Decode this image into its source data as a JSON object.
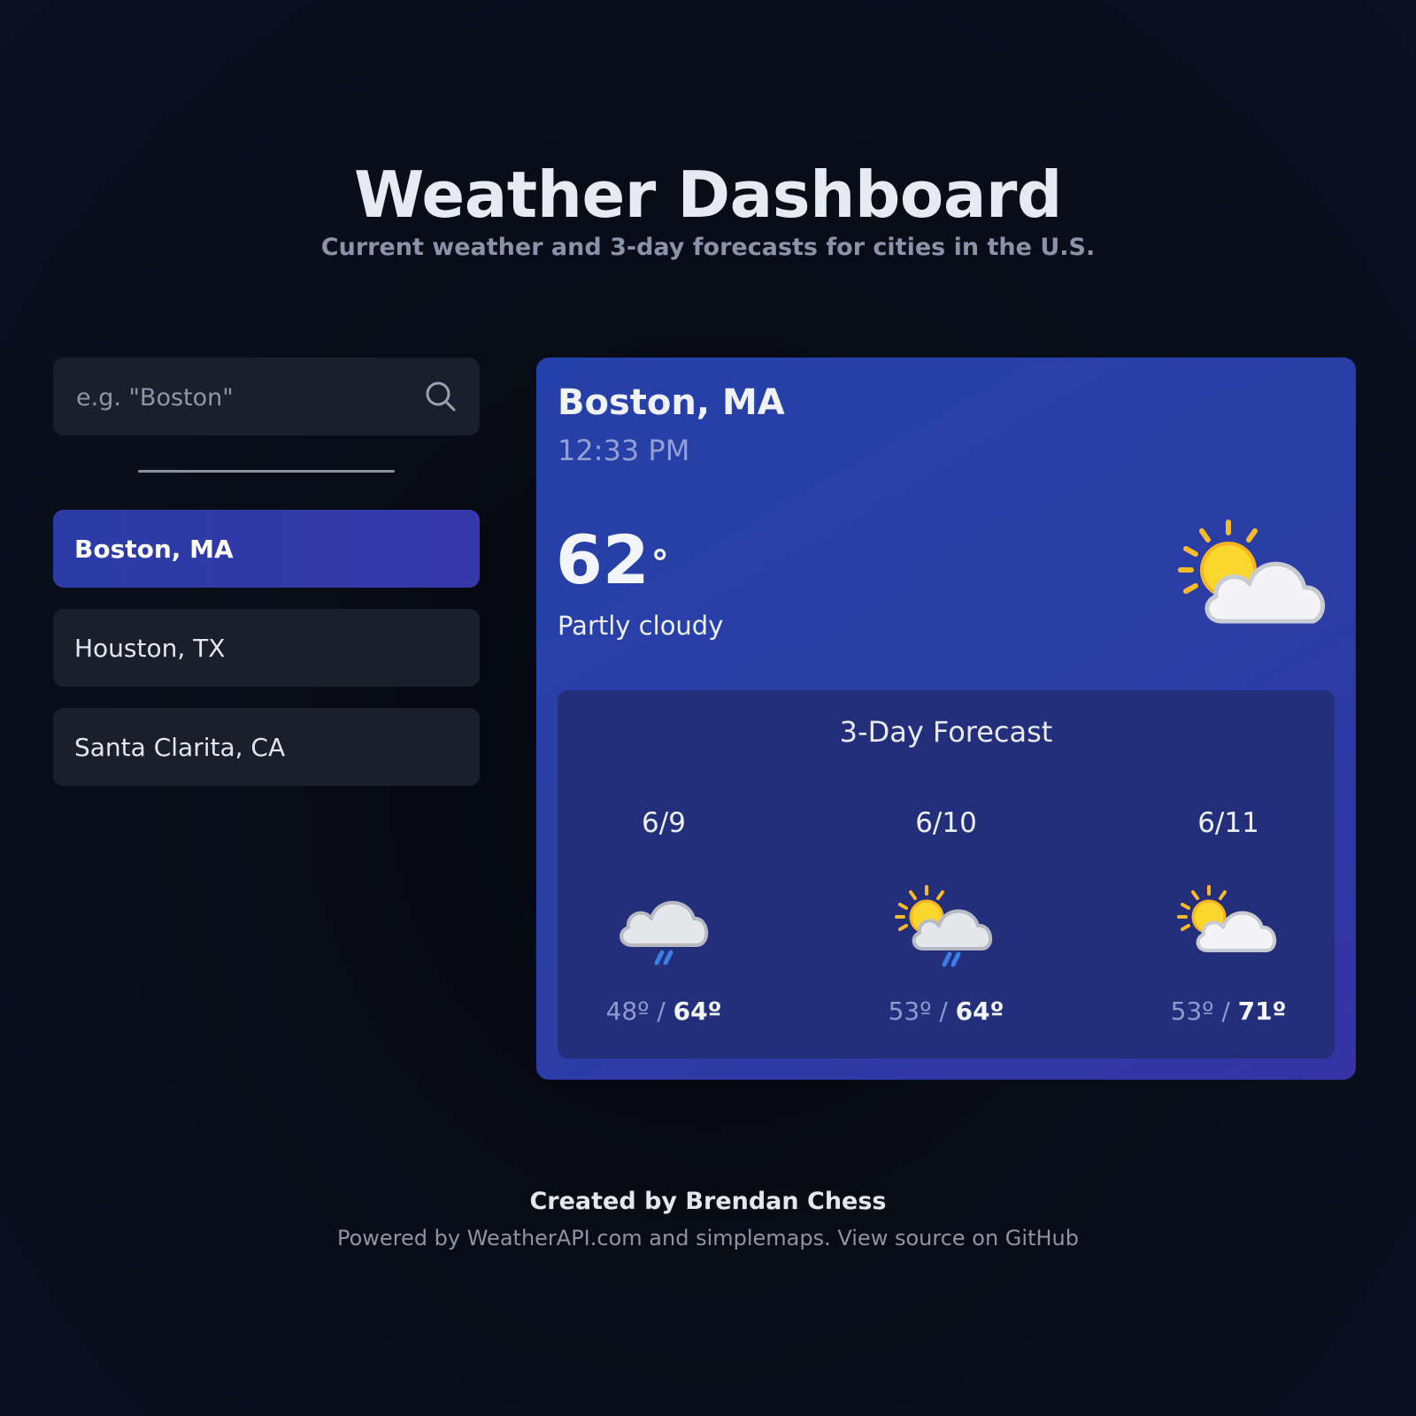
{
  "header": {
    "title": "Weather Dashboard",
    "subtitle": "Current weather and 3-day forecasts for cities in the U.S."
  },
  "search": {
    "placeholder": "e.g. \"Boston\"",
    "value": "",
    "icon": "search-icon"
  },
  "cities": [
    {
      "label": "Boston, MA",
      "active": true
    },
    {
      "label": "Houston, TX",
      "active": false
    },
    {
      "label": "Santa Clarita, CA",
      "active": false
    }
  ],
  "current": {
    "city": "Boston, MA",
    "time": "12:33 PM",
    "temp": "62",
    "degree": "°",
    "condition": "Partly cloudy",
    "icon": "partly-cloudy-icon"
  },
  "forecast": {
    "title": "3-Day Forecast",
    "days": [
      {
        "date": "6/9",
        "icon": "rain-cloud-icon",
        "low": "48º",
        "sep": "/",
        "high": "64º"
      },
      {
        "date": "6/10",
        "icon": "sun-cloud-rain-icon",
        "low": "53º",
        "sep": "/",
        "high": "64º"
      },
      {
        "date": "6/11",
        "icon": "partly-cloudy-icon",
        "low": "53º",
        "sep": "/",
        "high": "71º"
      }
    ]
  },
  "footer": {
    "credit": "Created by Brendan Chess",
    "powered_prefix": "Powered by ",
    "weatherapi": "WeatherAPI.com",
    "and": " and ",
    "simplemaps": "simplemaps",
    "dot": ". ",
    "source": "View source on GitHub"
  },
  "colors": {
    "background": "#0b1120",
    "panel": "#1a1f2b",
    "accent": "#2b3ca6",
    "card": "#2540a8",
    "forecast_panel": "#232f7a",
    "sun": "#f9c52b",
    "rain": "#3a7ee6"
  }
}
